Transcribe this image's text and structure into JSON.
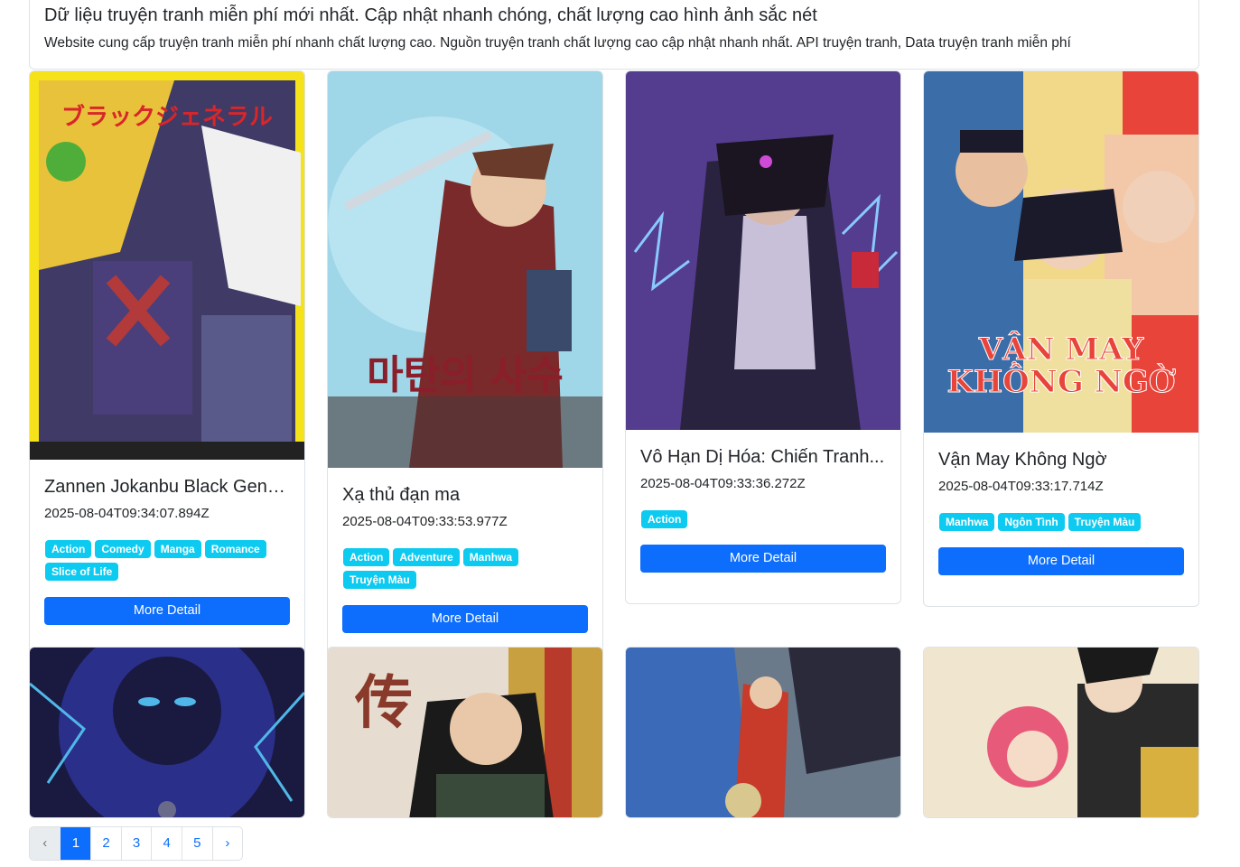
{
  "hero": {
    "title": "Dữ liệu truyện tranh miễn phí mới nhất. Cập nhật nhanh chóng, chất lượng cao hình ảnh sắc nét",
    "description": "Website cung cấp truyện tranh miễn phí nhanh chất lượng cao. Nguồn truyện tranh chất lượng cao cập nhật nhanh nhất. API truyện tranh, Data truyện tranh miễn phí"
  },
  "button_label": "More Detail",
  "comics": [
    {
      "title": "Zannen Jokanbu Black Gene...",
      "date": "2025-08-04T09:34:07.894Z",
      "tags": [
        "Action",
        "Comedy",
        "Manga",
        "Romance",
        "Slice of Life"
      ],
      "cover_text": "ブラックジェネラル",
      "cover_colors": [
        "#f5e21a",
        "#3f3a66",
        "#b23a3a"
      ]
    },
    {
      "title": "Xạ thủ đạn ma",
      "date": "2025-08-04T09:33:53.977Z",
      "tags": [
        "Action",
        "Adventure",
        "Manhwa",
        "Truyện Màu"
      ],
      "cover_text": "마탄의 사수",
      "cover_colors": [
        "#9fd6e8",
        "#7a2a2a",
        "#3a4a6a"
      ]
    },
    {
      "title": "Vô Hạn Dị Hóa: Chiến Tranh...",
      "date": "2025-08-04T09:33:36.272Z",
      "tags": [
        "Action"
      ],
      "cover_text": "",
      "cover_colors": [
        "#6a4bb8",
        "#2a2340",
        "#c8c0d8"
      ]
    },
    {
      "title": "Vận May Không Ngờ",
      "date": "2025-08-04T09:33:17.714Z",
      "tags": [
        "Manhwa",
        "Ngôn Tình",
        "Truyện Màu"
      ],
      "cover_text": "VẬN MAY KHÔNG NGỜ",
      "cover_colors": [
        "#f2d98a",
        "#e8443a",
        "#3b6ea8"
      ]
    },
    {
      "title": "",
      "date": "",
      "tags": [],
      "cover_text": "",
      "cover_colors": [
        "#2a2f8a",
        "#4fb8e8",
        "#1a1a40"
      ]
    },
    {
      "title": "",
      "date": "",
      "tags": [],
      "cover_text": "传",
      "cover_colors": [
        "#e6ddd0",
        "#3a4a3a",
        "#c8a040"
      ]
    },
    {
      "title": "",
      "date": "",
      "tags": [],
      "cover_text": "",
      "cover_colors": [
        "#3a6ab8",
        "#c83a2a",
        "#6a7a8a"
      ]
    },
    {
      "title": "",
      "date": "",
      "tags": [],
      "cover_text": "",
      "cover_colors": [
        "#f0e6d0",
        "#e85a7a",
        "#2a2a2a"
      ]
    }
  ],
  "pagination": {
    "prev": "‹",
    "pages": [
      "1",
      "2",
      "3",
      "4",
      "5"
    ],
    "next": "›",
    "active_page": "1"
  }
}
